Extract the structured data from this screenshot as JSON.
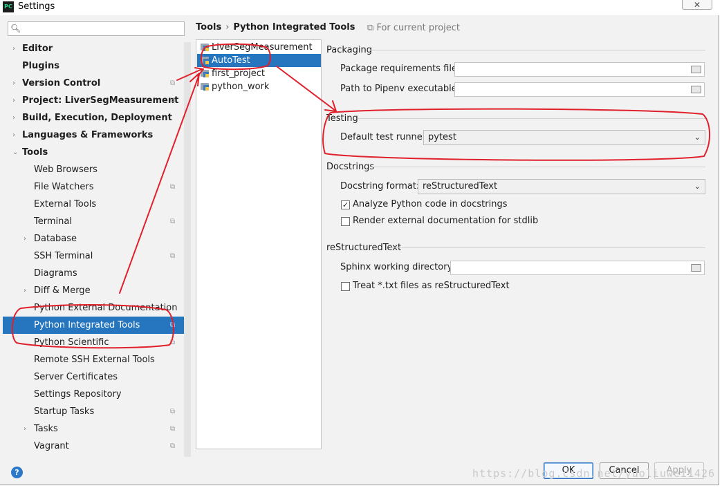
{
  "window": {
    "title": "Settings",
    "app_icon": "pycharm-icon",
    "close_label": "✕"
  },
  "search": {
    "placeholder": "",
    "icon": "search-icon"
  },
  "tree": [
    {
      "label": "Editor",
      "bold": true,
      "arrow": "›",
      "level": 0
    },
    {
      "label": "Plugins",
      "bold": true,
      "arrow": "",
      "level": 0
    },
    {
      "label": "Version Control",
      "bold": true,
      "arrow": "›",
      "level": 0,
      "project": true
    },
    {
      "label": "Project: LiverSegMeasurement",
      "bold": true,
      "arrow": "›",
      "level": 0,
      "project": true
    },
    {
      "label": "Build, Execution, Deployment",
      "bold": true,
      "arrow": "›",
      "level": 0
    },
    {
      "label": "Languages & Frameworks",
      "bold": true,
      "arrow": "›",
      "level": 0
    },
    {
      "label": "Tools",
      "bold": true,
      "arrow": "⌄",
      "level": 0
    },
    {
      "label": "Web Browsers",
      "bold": false,
      "arrow": "",
      "level": 1
    },
    {
      "label": "File Watchers",
      "bold": false,
      "arrow": "",
      "level": 1,
      "project": true
    },
    {
      "label": "External Tools",
      "bold": false,
      "arrow": "",
      "level": 1
    },
    {
      "label": "Terminal",
      "bold": false,
      "arrow": "",
      "level": 1,
      "project": true
    },
    {
      "label": "Database",
      "bold": false,
      "arrow": "›",
      "level": 1
    },
    {
      "label": "SSH Terminal",
      "bold": false,
      "arrow": "",
      "level": 1,
      "project": true
    },
    {
      "label": "Diagrams",
      "bold": false,
      "arrow": "",
      "level": 1
    },
    {
      "label": "Diff & Merge",
      "bold": false,
      "arrow": "›",
      "level": 1
    },
    {
      "label": "Python External Documentation",
      "bold": false,
      "arrow": "",
      "level": 1
    },
    {
      "label": "Python Integrated Tools",
      "bold": false,
      "arrow": "",
      "level": 1,
      "project": true,
      "selected": true
    },
    {
      "label": "Python Scientific",
      "bold": false,
      "arrow": "",
      "level": 1,
      "project": true
    },
    {
      "label": "Remote SSH External Tools",
      "bold": false,
      "arrow": "",
      "level": 1
    },
    {
      "label": "Server Certificates",
      "bold": false,
      "arrow": "",
      "level": 1
    },
    {
      "label": "Settings Repository",
      "bold": false,
      "arrow": "",
      "level": 1
    },
    {
      "label": "Startup Tasks",
      "bold": false,
      "arrow": "",
      "level": 1,
      "project": true
    },
    {
      "label": "Tasks",
      "bold": false,
      "arrow": "›",
      "level": 1,
      "project": true
    },
    {
      "label": "Vagrant",
      "bold": false,
      "arrow": "",
      "level": 1,
      "project": true
    }
  ],
  "breadcrumb": {
    "parent": "Tools",
    "separator": "›",
    "current": "Python Integrated Tools",
    "scope_icon": "copy-icon",
    "scope": "For current project"
  },
  "projects": [
    {
      "name": "LiverSegMeasurement",
      "selected": false
    },
    {
      "name": "AutoTest",
      "selected": true
    },
    {
      "name": "first_project",
      "selected": false
    },
    {
      "name": "python_work",
      "selected": false
    }
  ],
  "packaging": {
    "section": "Packaging",
    "req_label": "Package requirements file:",
    "req_value": "",
    "pipenv_label": "Path to Pipenv executable:",
    "pipenv_value": ""
  },
  "testing": {
    "section": "Testing",
    "runner_label": "Default test runner:",
    "runner_value": "pytest"
  },
  "docstrings": {
    "section": "Docstrings",
    "format_label": "Docstring format:",
    "format_value": "reStructuredText",
    "analyze_label": "Analyze Python code in docstrings",
    "analyze_checked": true,
    "render_label": "Render external documentation for stdlib",
    "render_checked": false
  },
  "rst": {
    "section": "reStructuredText",
    "sphinx_label": "Sphinx working directory:",
    "sphinx_value": "",
    "txt_label": "Treat *.txt files as reStructuredText",
    "txt_checked": false
  },
  "buttons": {
    "ok": "OK",
    "cancel": "Cancel",
    "apply": "Apply",
    "help": "?"
  },
  "watermark": "https://blog.csdn.net/yuoliuwei1426",
  "colors": {
    "selection": "#2675bf",
    "annotation": "#e0202a"
  }
}
